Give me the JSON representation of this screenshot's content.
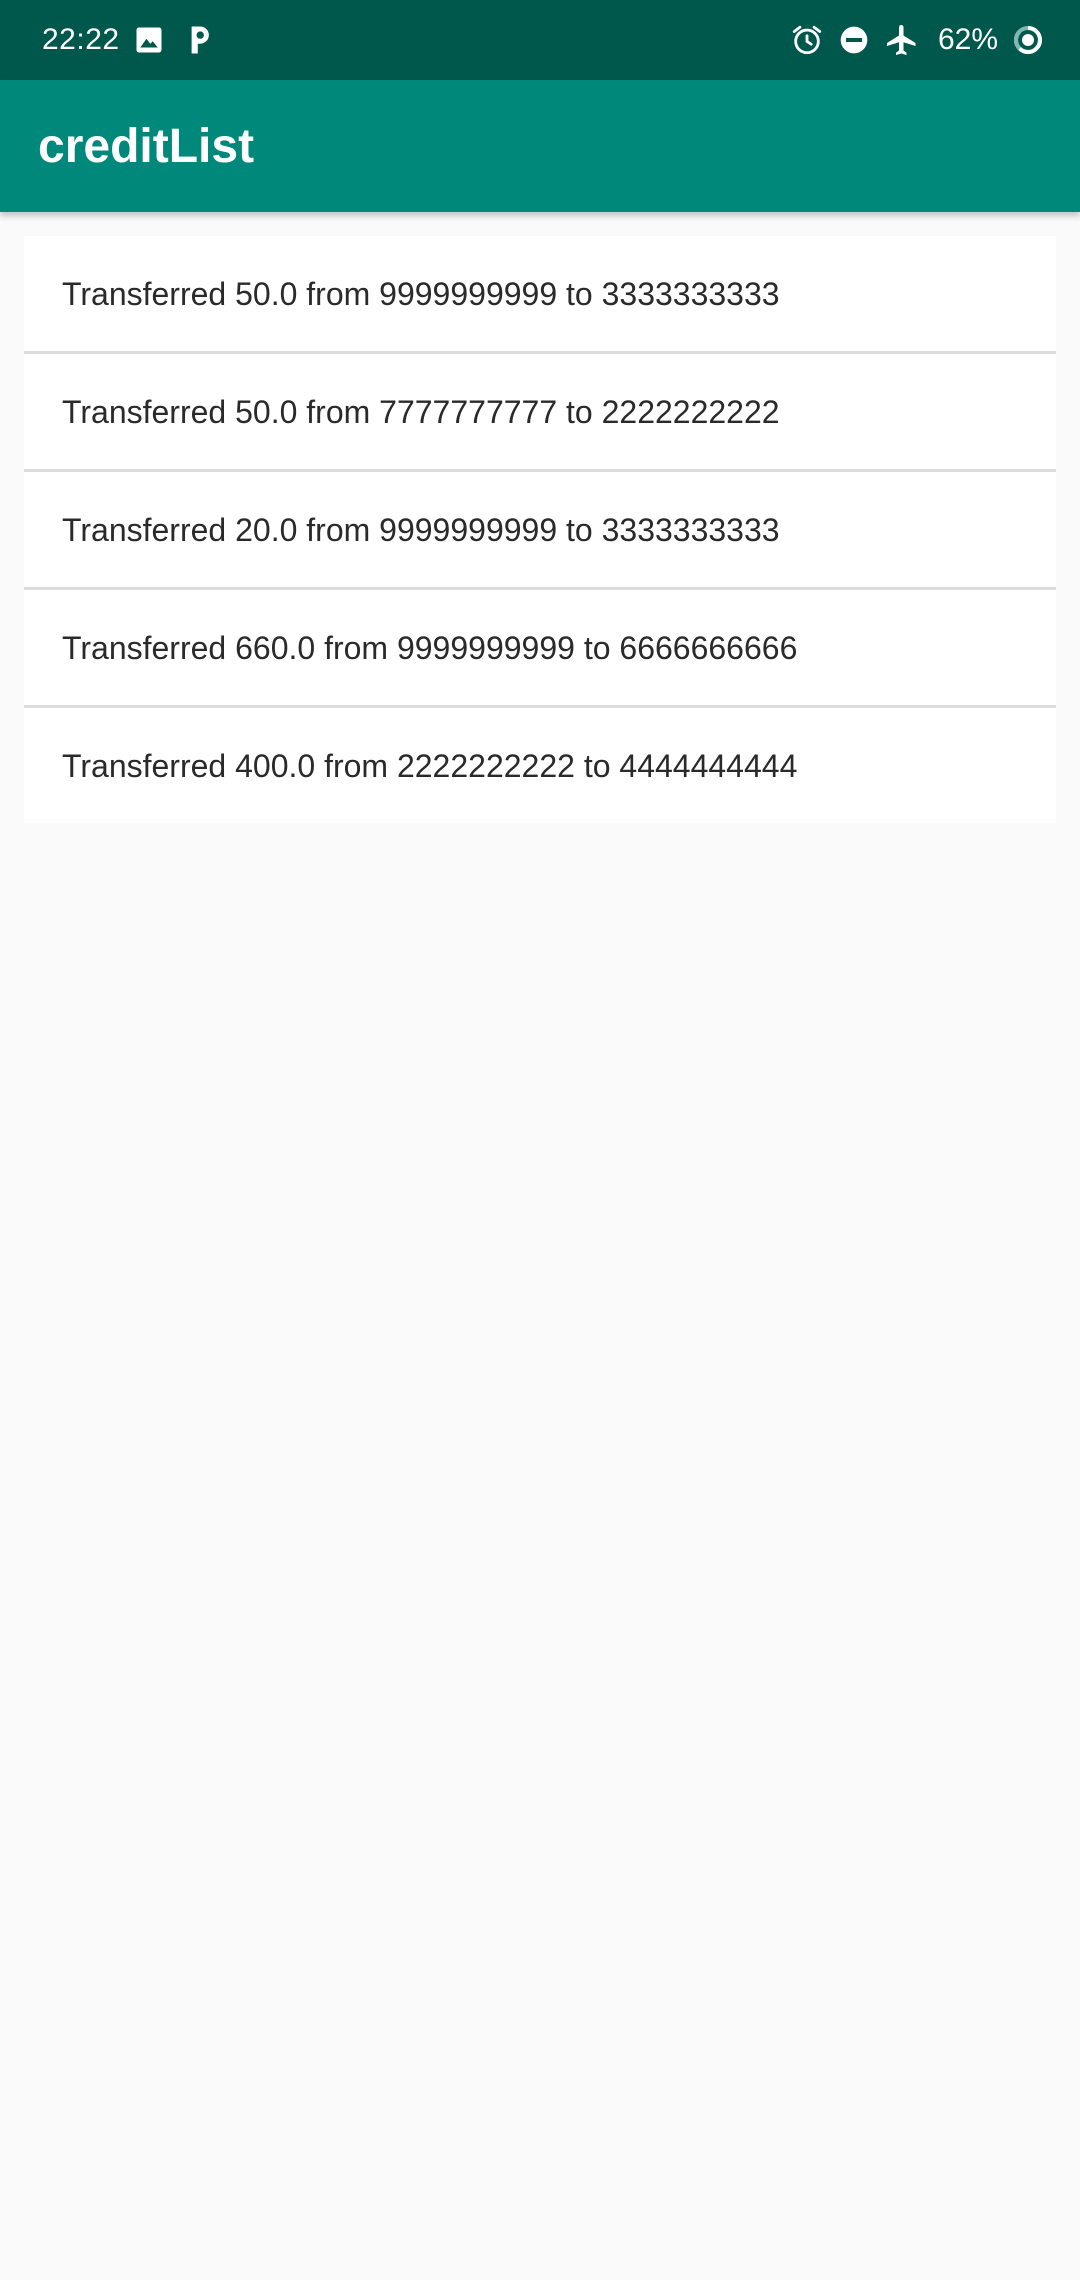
{
  "status_bar": {
    "time": "22:22",
    "battery": "62%",
    "icons_left": [
      "image-icon",
      "parking-icon"
    ],
    "icons_right": [
      "alarm-icon",
      "do-not-disturb-icon",
      "airplane-mode-icon",
      "battery-icon"
    ],
    "background": "#00574b"
  },
  "app_bar": {
    "title": "creditList",
    "background": "#00897b"
  },
  "transfers": [
    {
      "text": "Transferred 50.0 from 9999999999 to 3333333333"
    },
    {
      "text": "Transferred 50.0 from 7777777777 to 2222222222"
    },
    {
      "text": "Transferred 20.0 from 9999999999 to 3333333333"
    },
    {
      "text": "Transferred 660.0 from 9999999999 to 6666666666"
    },
    {
      "text": "Transferred 400.0 from 2222222222 to 4444444444"
    }
  ]
}
